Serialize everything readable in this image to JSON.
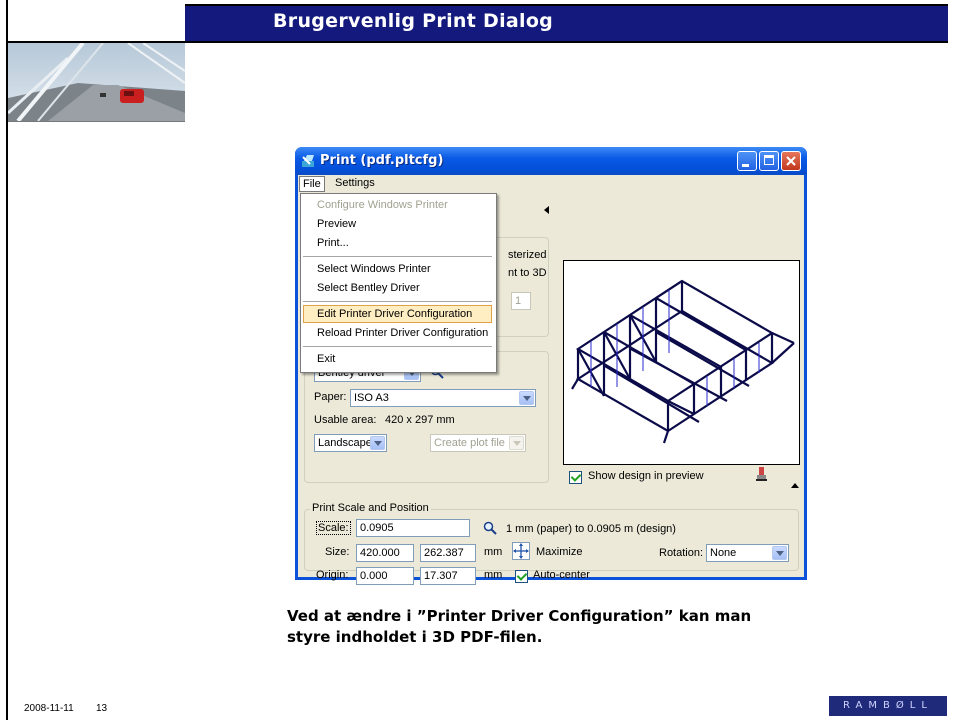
{
  "slide": {
    "title": "Brugervenlig Print Dialog",
    "caption_line1": "Ved at ændre i ”Printer Driver Configuration” kan man",
    "caption_line2": "styre indholdet i 3D PDF-filen.",
    "footer_date": "2008-11-11",
    "footer_page": "13",
    "logo_text": "RAMBØLL"
  },
  "window": {
    "title": "Print  (pdf.pltcfg)",
    "menus": [
      {
        "label": "File"
      },
      {
        "label": "Settings"
      }
    ],
    "file_menu": [
      {
        "label": "Configure Windows Printer",
        "disabled": true
      },
      {
        "label": "Preview"
      },
      {
        "label": "Print..."
      },
      {
        "label": "Select Windows Printer"
      },
      {
        "label": "Select Bentley Driver"
      },
      {
        "label": "Edit Printer Driver Configuration",
        "highlighted": true
      },
      {
        "label": "Reload Printer Driver Configuration"
      },
      {
        "label": "Exit"
      }
    ],
    "partial": {
      "rasterized": "sterized",
      "to3d": "nt to 3D",
      "copies": "1"
    },
    "printer": {
      "driver_value": "Bentley driver",
      "paper_label": "Paper:",
      "paper_value": "ISO A3",
      "usable_area_label": "Usable area:",
      "usable_area_value": "420 x 297 mm",
      "orientation_value": "Landscape",
      "create_plot_file": "Create plot file"
    },
    "preview": {
      "show_design_label": "Show design in preview",
      "show_design_checked": true
    },
    "scale_position": {
      "group_title": "Print Scale and Position",
      "scale_label": "Scale:",
      "scale_value": "0.0905",
      "scale_text": "1 mm (paper) to 0.0905 m (design)",
      "size_label": "Size:",
      "size_x": "420.000",
      "size_y": "262.387",
      "size_unit": "mm",
      "maximize_label": "Maximize",
      "rotation_label": "Rotation:",
      "rotation_value": "None",
      "origin_label": "Origin:",
      "origin_x": "0.000",
      "origin_y": "17.307",
      "origin_unit": "mm",
      "autocenter_label": "Auto-center",
      "autocenter_checked": true
    }
  },
  "colors": {
    "title_bar": "#141a7d",
    "xp_blue": "#0a52d9",
    "dialog_face": "#ece9d8",
    "menu_highlight": "#ffeec2"
  }
}
